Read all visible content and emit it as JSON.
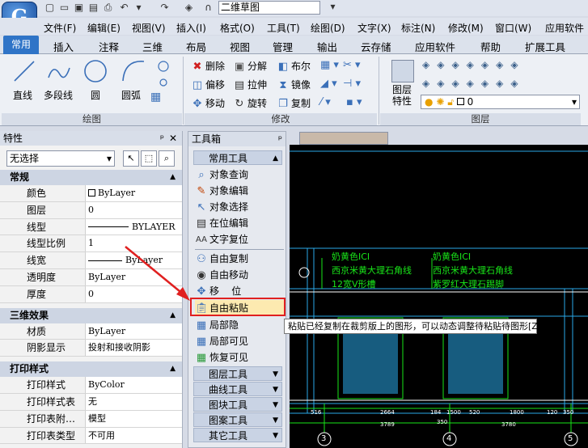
{
  "app": {
    "doc_title": "二维草图",
    "logo_letter": "G"
  },
  "menubar": [
    "文件(F)",
    "编辑(E)",
    "视图(V)",
    "插入(I)",
    "格式(O)",
    "工具(T)",
    "绘图(D)",
    "文字(X)",
    "标注(N)",
    "修改(M)",
    "窗口(W)",
    "应用软件"
  ],
  "ribbon_tabs": [
    "常用",
    "插入",
    "注释",
    "三维",
    "布局",
    "视图",
    "管理",
    "输出",
    "云存储",
    "应用软件",
    "帮助",
    "扩展工具"
  ],
  "ribbon": {
    "draw": {
      "label": "绘图",
      "tools": [
        "直线",
        "多段线",
        "圆",
        "圆弧"
      ]
    },
    "modify": {
      "label": "修改",
      "tools": [
        "删除",
        "分解",
        "布尔",
        "偏移",
        "拉伸",
        "镜像",
        "移动",
        "旋转",
        "复制"
      ]
    },
    "layer": {
      "label": "图层",
      "tool": "图层\n特性",
      "tool_line1": "图层",
      "tool_line2": "特性",
      "current": "0"
    }
  },
  "properties": {
    "title": "特性",
    "selection": "无选择",
    "sections": [
      {
        "name": "常规",
        "rows": [
          [
            "颜色",
            "ByLayer"
          ],
          [
            "图层",
            "0"
          ],
          [
            "线型",
            "BYLAYER"
          ],
          [
            "线型比例",
            "1"
          ],
          [
            "线宽",
            "ByLayer"
          ],
          [
            "透明度",
            "ByLayer"
          ],
          [
            "厚度",
            "0"
          ]
        ]
      },
      {
        "name": "三维效果",
        "rows": [
          [
            "材质",
            "ByLayer"
          ],
          [
            "阴影显示",
            "投射和接收阴影"
          ]
        ]
      },
      {
        "name": "打印样式",
        "rows": [
          [
            "打印样式",
            "ByColor"
          ],
          [
            "打印样式表",
            "无"
          ],
          [
            "打印表附…",
            "模型"
          ],
          [
            "打印表类型",
            "不可用"
          ]
        ]
      }
    ]
  },
  "toolbox": {
    "title": "工具箱",
    "group_common": "常用工具",
    "items": [
      "对象查询",
      "对象编辑",
      "对象选择",
      "在位编辑",
      "文字复位",
      "自由复制",
      "自由移动",
      "移    位",
      "自由粘贴",
      "局部隐",
      "局部可见",
      "恢复可见"
    ],
    "groups": [
      "图层工具",
      "曲线工具",
      "图块工具",
      "图案工具",
      "其它工具"
    ]
  },
  "tooltip": "粘贴已经复制在裁剪版上的图形，可以动态调整待粘贴待图形[ZYNT]",
  "drawing": {
    "labels": [
      "奶黄色ICI",
      "西京米黄大理石角线",
      "12宽V形槽",
      "奶黄色ICI",
      "西京米黄大理石角线",
      "紫罗红大理石踢脚"
    ],
    "dims": [
      "516",
      "2664",
      "184",
      "1500",
      "520",
      "1800",
      "120",
      "350",
      "3789",
      "350",
      "3780"
    ],
    "axis": [
      "3",
      "4",
      "5"
    ]
  },
  "colors": {
    "accent": "#2f74c7",
    "cad_green": "#19e619",
    "cad_cyan": "#2aa8e8",
    "alert": "#e02020"
  }
}
